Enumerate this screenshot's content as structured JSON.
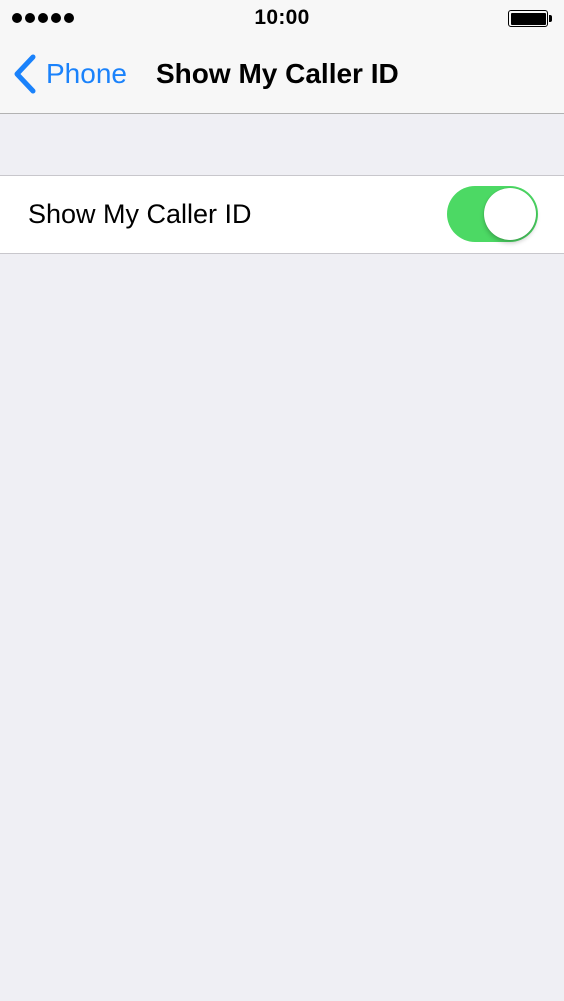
{
  "status_bar": {
    "time": "10:00",
    "signal_dots": 5,
    "battery_level": 1.0,
    "icons": {
      "signal": "signal-dots-icon",
      "battery": "battery-icon"
    }
  },
  "nav": {
    "back_label": "Phone",
    "back_icon": "chevron-left-icon",
    "title": "Show My Caller ID"
  },
  "settings": {
    "show_caller_id": {
      "label": "Show My Caller ID",
      "enabled": true
    }
  },
  "colors": {
    "accent": "#1a82fb",
    "toggle_on": "#4cd964",
    "toggle_off": "#e5e5ea",
    "background": "#efeff4",
    "bar_background": "#f7f7f7"
  }
}
